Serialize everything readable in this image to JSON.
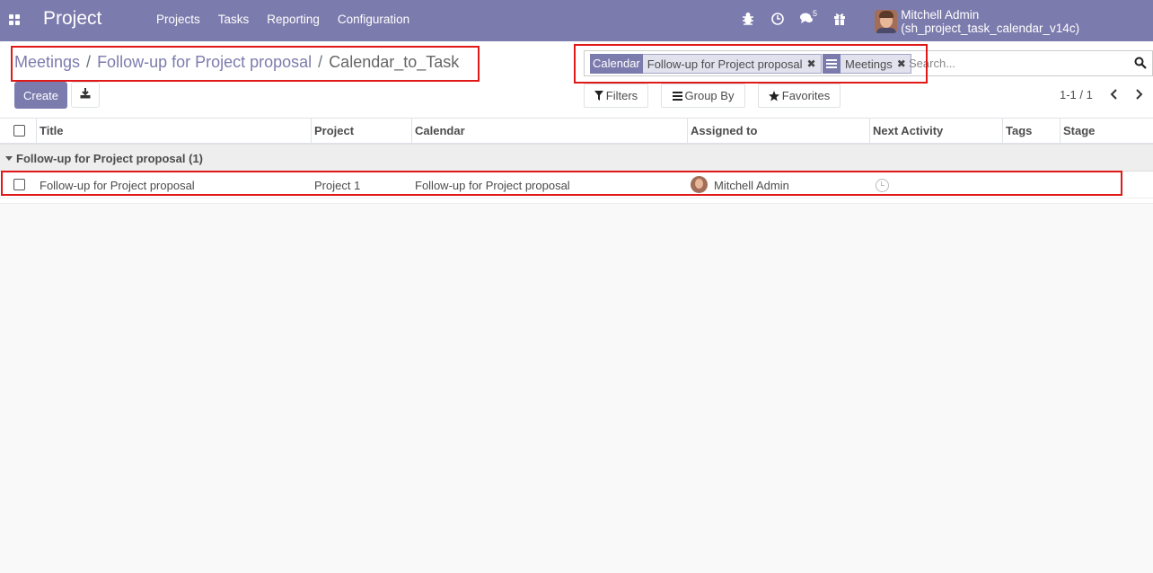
{
  "navbar": {
    "app_title": "Project",
    "menu": [
      "Projects",
      "Tasks",
      "Reporting",
      "Configuration"
    ],
    "message_count": "5",
    "user_name": "Mitchell Admin (sh_project_task_calendar_v14c)",
    "icons": [
      "apps-icon",
      "bug-icon",
      "clock-icon",
      "chat-icon",
      "gift-icon"
    ]
  },
  "breadcrumb": {
    "items": [
      "Meetings",
      "Follow-up for Project proposal"
    ],
    "current": "Calendar_to_Task",
    "separator": "/"
  },
  "toolbar": {
    "create_label": "Create",
    "download_icon": "download-icon"
  },
  "search": {
    "facets": [
      {
        "label": "Calendar",
        "value": "Follow-up for Project proposal"
      },
      {
        "label_icon": "group-by-icon",
        "value": "Meetings"
      }
    ],
    "placeholder": "Search..."
  },
  "search_buttons": {
    "filters": "Filters",
    "group_by": "Group By",
    "favorites": "Favorites"
  },
  "pager": {
    "text": "1-1 / 1"
  },
  "table": {
    "columns": [
      "Title",
      "Project",
      "Calendar",
      "Assigned to",
      "Next Activity",
      "Tags",
      "Stage"
    ],
    "group": {
      "label": "Follow-up for Project proposal (1)"
    },
    "rows": [
      {
        "title": "Follow-up for Project proposal",
        "project": "Project 1",
        "calendar": "Follow-up for Project proposal",
        "assigned_to": "Mitchell Admin",
        "next_activity": "",
        "tags": "",
        "stage": ""
      }
    ]
  },
  "colors": {
    "brand": "#7c7bad",
    "highlight": "#e01818"
  }
}
